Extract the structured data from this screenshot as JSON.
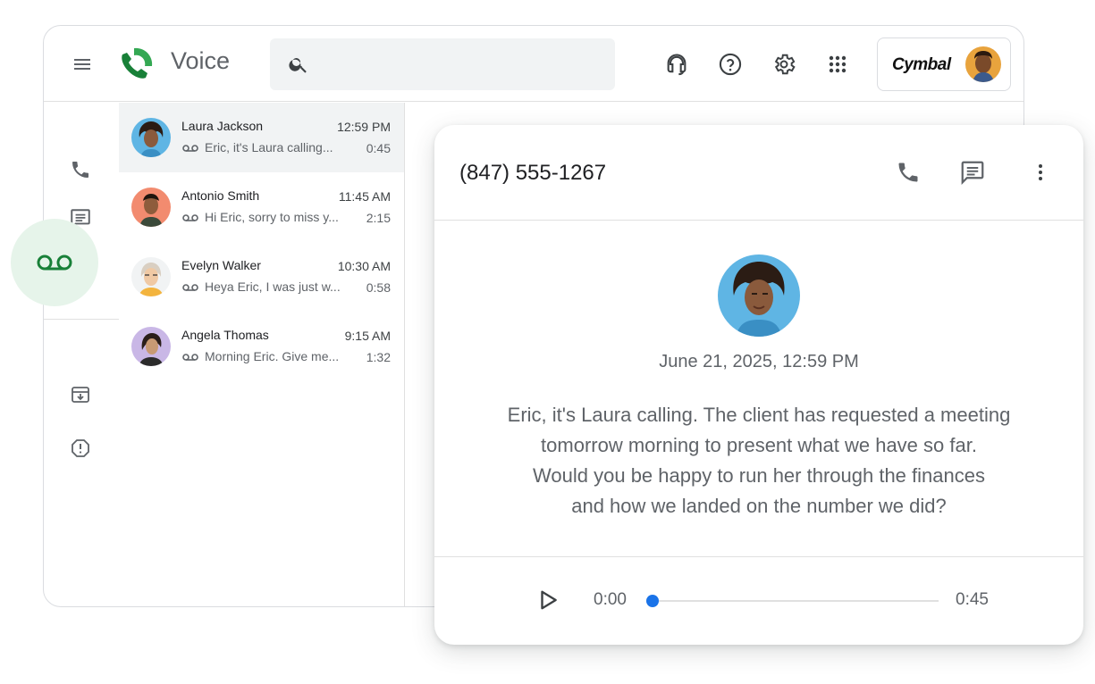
{
  "app": {
    "name": "Voice",
    "brand": "Cymbal"
  },
  "search": {
    "placeholder": "",
    "value": ""
  },
  "topbar_icons": [
    "headset-icon",
    "help-icon",
    "settings-icon",
    "apps-grid-icon"
  ],
  "rail": {
    "items": [
      "phone-icon",
      "message-icon",
      "voicemail-icon",
      "archive-icon",
      "spam-icon"
    ],
    "active": "voicemail"
  },
  "voicemails": [
    {
      "name": "Laura Jackson",
      "time": "12:59 PM",
      "snippet": "Eric, it's Laura calling...",
      "duration": "0:45",
      "selected": true
    },
    {
      "name": "Antonio Smith",
      "time": "11:45 AM",
      "snippet": "Hi Eric, sorry to miss y...",
      "duration": "2:15",
      "selected": false
    },
    {
      "name": "Evelyn Walker",
      "time": "10:30 AM",
      "snippet": "Heya Eric, I was just w...",
      "duration": "0:58",
      "selected": false
    },
    {
      "name": "Angela Thomas",
      "time": "9:15 AM",
      "snippet": "Morning Eric. Give me...",
      "duration": "1:32",
      "selected": false
    }
  ],
  "detail": {
    "phone_number": "(847) 555-1267",
    "date": "June 21, 2025, 12:59 PM",
    "transcript_lines": [
      "Eric, it's Laura calling. The client has requested a meeting",
      "tomorrow morning to present what we have so far.",
      "Would you be happy to run her through the finances",
      "and how we landed on the number we did?"
    ],
    "player": {
      "current": "0:00",
      "total": "0:45",
      "progress": 0.0
    }
  },
  "colors": {
    "accent_green": "#188038",
    "active_bg": "#e6f4ea",
    "progress_blue": "#1a73e8",
    "icon_gray": "#5f6368"
  }
}
